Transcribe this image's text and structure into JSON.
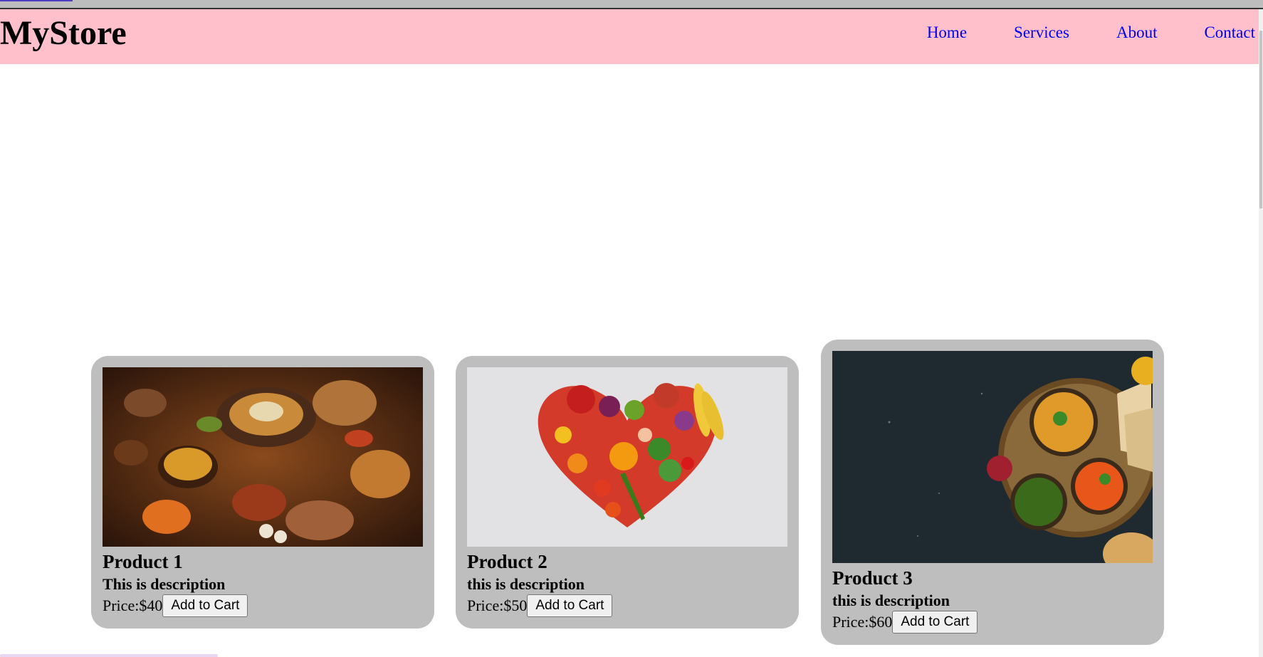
{
  "header": {
    "logo": "MyStore",
    "nav": [
      "Home",
      "Services",
      "About",
      "Contact"
    ]
  },
  "products": [
    {
      "title": "Product 1",
      "description": "This is description",
      "price": "Price:$40",
      "button": "Add to Cart",
      "image": "food-spread-image"
    },
    {
      "title": "Product 2",
      "description": "this is description",
      "price": "Price:$50",
      "button": "Add to Cart",
      "image": "vegetable-heart-image"
    },
    {
      "title": "Product 3",
      "description": "this is description",
      "price": "Price:$60",
      "button": "Add to Cart",
      "image": "curry-platter-image"
    }
  ],
  "colors": {
    "navbar": "#ffc0cb",
    "link": "#0000ee",
    "card": "#bebebe"
  }
}
